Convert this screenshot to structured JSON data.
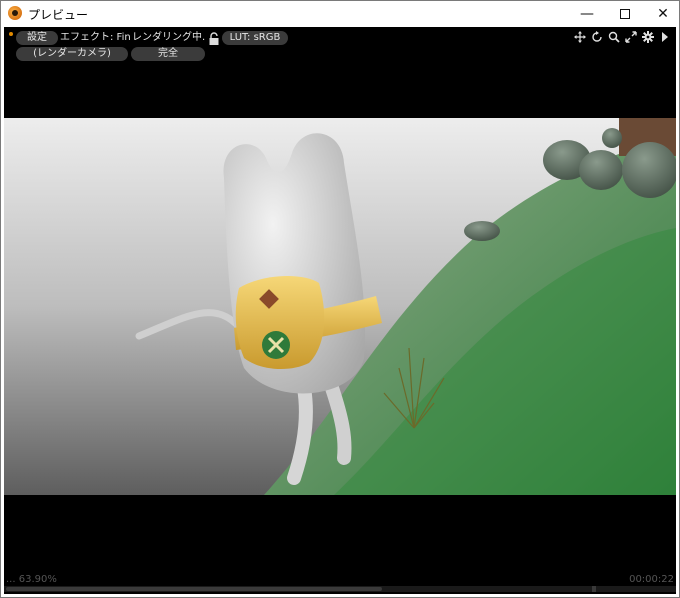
{
  "window": {
    "title": "プレビュー",
    "minimize_symbol": "—",
    "maximize_symbol": "☐",
    "close_symbol": "✕"
  },
  "toolbar": {
    "settings_label": "設定",
    "effect_label": "エフェクト: Fin...",
    "rendering_label": "レンダリング中...",
    "lut_label": "LUT: sRGB",
    "camera_label": "(レンダーカメラ)",
    "quality_label": "完全"
  },
  "toolbar_icons": [
    "move-icon",
    "rotate-icon",
    "zoom-icon",
    "fit-icon",
    "gear-icon",
    "play-icon"
  ],
  "status": {
    "zoom": "... 63.90%",
    "time": "00:00:22"
  },
  "colors": {
    "accent_dot": "#e08a00",
    "viewport_bg": "#000000",
    "pill_bg": "#3b3b3b"
  }
}
